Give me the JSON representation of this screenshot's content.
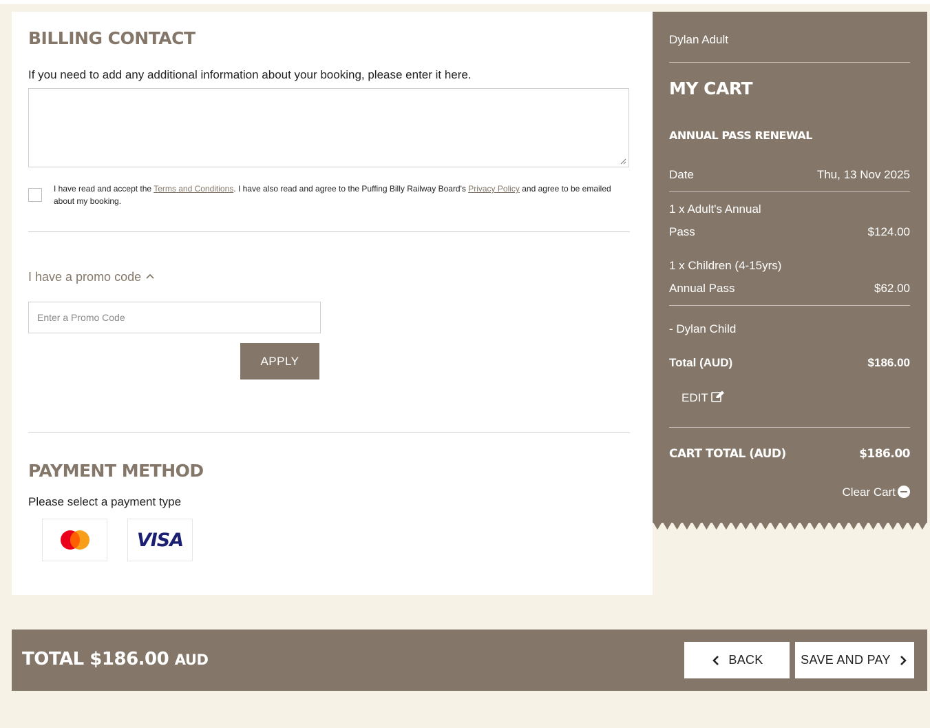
{
  "billing": {
    "title": "BILLING CONTACT",
    "description": "If you need to add any additional information about your booking, please enter it here.",
    "notes_value": "",
    "terms": {
      "prefix": "I have read and accept the ",
      "terms_link": "Terms and Conditions",
      "middle": ". I have also read and agree to the Puffing Billy Railway Board's ",
      "privacy_link": "Privacy Policy",
      "suffix": " and agree to be emailed about my booking.",
      "checked": false
    }
  },
  "promo": {
    "toggle_label": "I have a promo code",
    "toggle_icon": "chevron-up-icon",
    "placeholder": "Enter a Promo Code",
    "apply_label": "APPLY"
  },
  "payment": {
    "title": "PAYMENT METHOD",
    "description": "Please select a payment type",
    "visa_text": "VISA",
    "cards": [
      "mastercard-icon",
      "visa-icon"
    ]
  },
  "cart": {
    "user": "Dylan Adult",
    "title": "MY CART",
    "subtitle": "ANNUAL PASS RENEWAL",
    "date_label": "Date",
    "date_value": "Thu, 13 Nov 2025",
    "items": [
      {
        "line1": "1 x Adult's Annual",
        "line2": "Pass",
        "price": "$124.00"
      },
      {
        "line1": "1 x Children (4-15yrs)",
        "line2": "Annual Pass",
        "price": "$62.00"
      }
    ],
    "child_name": "- Dylan Child",
    "total_label": "Total (AUD)",
    "total_value": "$186.00",
    "edit_label": "EDIT",
    "cart_total_label": "CART TOTAL (AUD)",
    "cart_total_value": "$186.00",
    "clear_label": "Clear Cart"
  },
  "footer": {
    "total_label": "TOTAL $186.00",
    "currency": "AUD",
    "back_label": "BACK",
    "save_label": "SAVE AND PAY"
  },
  "colors": {
    "brand": "#847769",
    "background": "#f6f2e6",
    "mastercard_red": "#eb001b",
    "mastercard_orange": "#f79e1b",
    "visa_blue": "#1a1f71"
  }
}
